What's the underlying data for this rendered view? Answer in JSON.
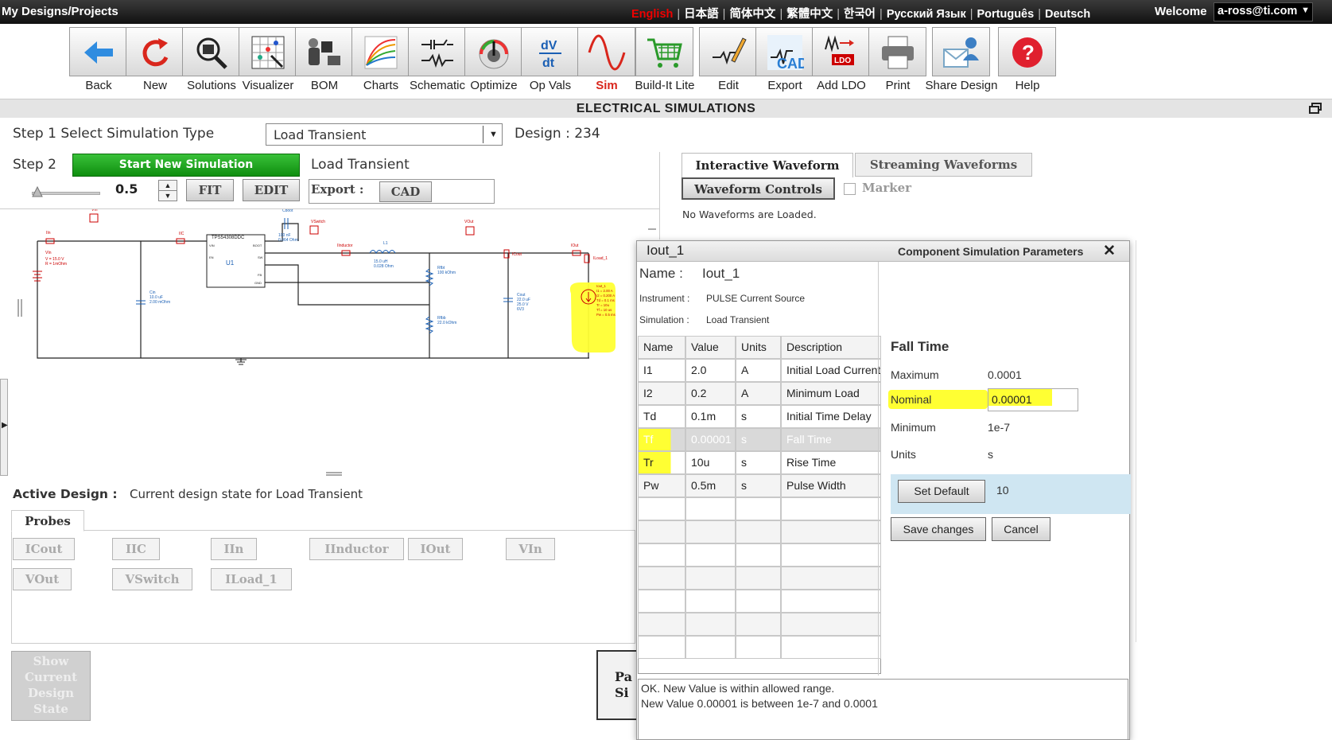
{
  "topbar": {
    "path": "My Designs/Projects",
    "languages": [
      "English",
      "日本語",
      "简体中文",
      "繁體中文",
      "한국어",
      "Русский Язык",
      "Português",
      "Deutsch"
    ],
    "active_language": "English",
    "welcome": "Welcome",
    "user": "a-ross@ti.com"
  },
  "toolbar": [
    {
      "label": "Back",
      "icon": "back-arrow-icon"
    },
    {
      "label": "New",
      "icon": "refresh-icon"
    },
    {
      "label": "Solutions",
      "icon": "magnifier-chip-icon"
    },
    {
      "label": "Visualizer",
      "icon": "grid-chart-icon"
    },
    {
      "label": "BOM",
      "icon": "components-icon"
    },
    {
      "label": "Charts",
      "icon": "curves-chart-icon"
    },
    {
      "label": "Schematic",
      "icon": "schematic-icon"
    },
    {
      "label": "Optimize",
      "icon": "dial-knob-icon"
    },
    {
      "label": "Op Vals",
      "icon": "dv-dt-icon"
    },
    {
      "label": "Sim",
      "icon": "sine-wave-icon"
    },
    {
      "label": "Build-It Lite",
      "icon": "cart-icon"
    },
    {
      "label": "Edit",
      "icon": "pencil-schematic-icon"
    },
    {
      "label": "Export",
      "icon": "cad-export-icon"
    },
    {
      "label": "Add LDO",
      "icon": "ldo-icon"
    },
    {
      "label": "Print",
      "icon": "printer-icon"
    },
    {
      "label": "Share Design",
      "icon": "share-envelope-icon"
    },
    {
      "label": "Help",
      "icon": "help-icon"
    }
  ],
  "section_title": "ELECTRICAL SIMULATIONS",
  "step1": {
    "label": "Step 1 Select Simulation Type",
    "selected": "Load Transient",
    "design_label": "Design : 234"
  },
  "step2": {
    "label": "Step 2",
    "start_btn": "Start New Simulation",
    "sim_name": "Load Transient",
    "zoom_value": "0.5",
    "fit_btn": "FIT",
    "edit_btn": "EDIT",
    "export_label": "Export :",
    "cad_btn": "CAD"
  },
  "schematic": {
    "labels": {
      "iin": "IIn",
      "vin": "VIn",
      "iic": "IIC",
      "cboot": "Cboot",
      "vswitch": "VSwitch",
      "iinductor": "IInductor",
      "l1": "L1",
      "vout": "VOut",
      "iout": "IOut",
      "icout": "ICout",
      "iload": "ILoad_1",
      "rfbt": "Rfbt",
      "rfbb": "Rfbb",
      "cout": "Cout",
      "cin": "Cin",
      "vin_src": "VIn",
      "u1": "U1",
      "ic_name": "TPS54308DDC",
      "iout1": "Iout_1"
    },
    "values": {
      "vin_src": "V = 15.0 V\nR = 1mOhm",
      "cin": "10.0 uF\n2.00 mOhm",
      "cboot": "100 nF\n0.064 Ohm",
      "l1": "15.0 uH\n0.028 Ohm",
      "rfbt": "100 kOhm",
      "rfbb": "22.0 kOhm",
      "cout": "22.0 uF\n25.0 V\n6V3",
      "iout1": "I1 = 2.00 A\nI2 = 0.200 A\nTd = 0.1 ms\nTr = 10u\nTf = 10 us\nPw = 0.5 ms"
    },
    "pins": [
      "VIN",
      "BOOT",
      "EN",
      "SW",
      "FB",
      "GND"
    ]
  },
  "waveforms": {
    "tab1": "Interactive Waveform",
    "tab2": "Streaming Waveforms",
    "controls_btn": "Waveform Controls",
    "marker_label": "Marker",
    "empty_msg": "No Waveforms are Loaded."
  },
  "active_design": {
    "label": "Active Design :",
    "value": "Current design state for Load Transient"
  },
  "probes": {
    "tab": "Probes",
    "items": [
      "ICout",
      "IIC",
      "IIn",
      "IInductor",
      "IOut",
      "VIn",
      "VOut",
      "VSwitch",
      "ILoad_1"
    ]
  },
  "show_state_btn": "Show Current Design State",
  "partial_btn": "Pa\nSi",
  "dialog": {
    "title": "Iout_1",
    "header_right": "Component Simulation Parameters",
    "name_label": "Name :",
    "name_value": "Iout_1",
    "instrument_label": "Instrument :",
    "instrument_value": "PULSE Current Source",
    "simulation_label": "Simulation :",
    "simulation_value": "Load Transient",
    "columns": [
      "Name",
      "Value",
      "Units",
      "Description"
    ],
    "rows": [
      [
        "I1",
        "2.0",
        "A",
        "Initial Load Current"
      ],
      [
        "I2",
        "0.2",
        "A",
        "Minimum Load"
      ],
      [
        "Td",
        "0.1m",
        "s",
        "Initial Time Delay"
      ],
      [
        "Tf",
        "0.00001",
        "s",
        "Fall Time"
      ],
      [
        "Tr",
        "10u",
        "s",
        "Rise Time"
      ],
      [
        "Pw",
        "0.5m",
        "s",
        "Pulse Width"
      ]
    ],
    "param_title": "Fall Time",
    "maximum_label": "Maximum",
    "maximum_value": "0.0001",
    "nominal_label": "Nominal",
    "nominal_value": "0.00001",
    "minimum_label": "Minimum",
    "minimum_value": "1e-7",
    "units_label": "Units",
    "units_value": "s",
    "set_default_btn": "Set Default",
    "default_value": "10",
    "save_btn": "Save changes",
    "cancel_btn": "Cancel",
    "status_line1": "OK. New Value is within allowed range.",
    "status_line2": "New Value 0.00001 is between 1e-7 and  0.0001"
  },
  "colors": {
    "highlight": "#ffff33",
    "green": "#1aa31a",
    "active_lang": "#e00000",
    "selected_row": "#d9d9d9",
    "default_panel": "#cfe6f2"
  }
}
